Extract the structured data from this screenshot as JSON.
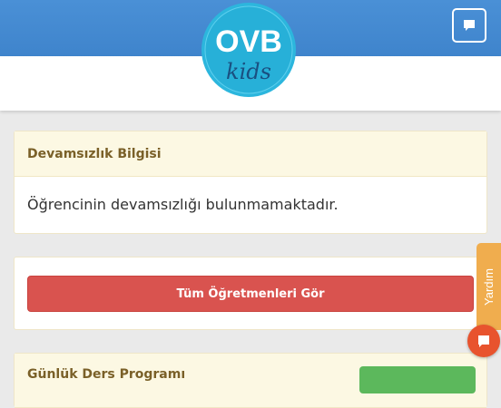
{
  "header": {
    "logo": {
      "top_text": "OVB",
      "bottom_text": "kids"
    },
    "chat_button_icon": "chat-bubble-icon"
  },
  "attendance_panel": {
    "title": "Devamsızlık Bilgisi",
    "message": "Öğrencinin devamsızlığı bulunmamaktadır."
  },
  "teachers_panel": {
    "button_label": "Tüm Öğretmenleri Gör"
  },
  "schedule_panel": {
    "title": "Günlük Ders Programı"
  },
  "help_widget": {
    "tab_label": "Yardım",
    "fab_icon": "chat-bubble-icon"
  },
  "colors": {
    "header_blue": "#4a90d6",
    "danger": "#d9534f",
    "success": "#5cb85c",
    "help_orange": "#f0ad4e",
    "fab_red": "#e8532e",
    "logo_cyan": "#2cb6dd"
  }
}
